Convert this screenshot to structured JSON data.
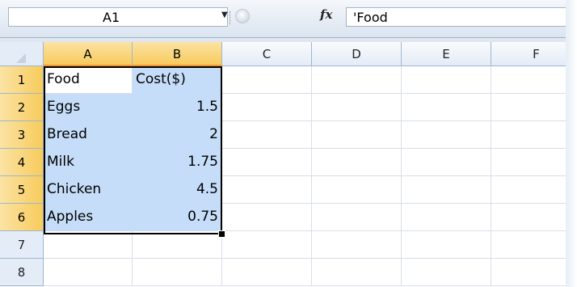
{
  "formula_bar": {
    "name_box": "A1",
    "name_box_dropdown_icon": "chevron-down-icon",
    "function_icon": "fx",
    "formula": "'Food"
  },
  "columns": [
    "A",
    "B",
    "C",
    "D",
    "E",
    "F"
  ],
  "rows": [
    "1",
    "2",
    "3",
    "4",
    "5",
    "6",
    "7",
    "8"
  ],
  "cells": [
    [
      "Food",
      "Cost($)",
      "",
      "",
      "",
      ""
    ],
    [
      "Eggs",
      "1.5",
      "",
      "",
      "",
      ""
    ],
    [
      "Bread",
      "2",
      "",
      "",
      "",
      ""
    ],
    [
      "Milk",
      "1.75",
      "",
      "",
      "",
      ""
    ],
    [
      "Chicken",
      "4.5",
      "",
      "",
      "",
      ""
    ],
    [
      "Apples",
      "0.75",
      "",
      "",
      "",
      ""
    ],
    [
      "",
      "",
      "",
      "",
      "",
      ""
    ],
    [
      "",
      "",
      "",
      "",
      "",
      ""
    ]
  ],
  "colors": {
    "selection_fill": "#c5ddf8",
    "header_highlight": "#f8cb5c"
  }
}
